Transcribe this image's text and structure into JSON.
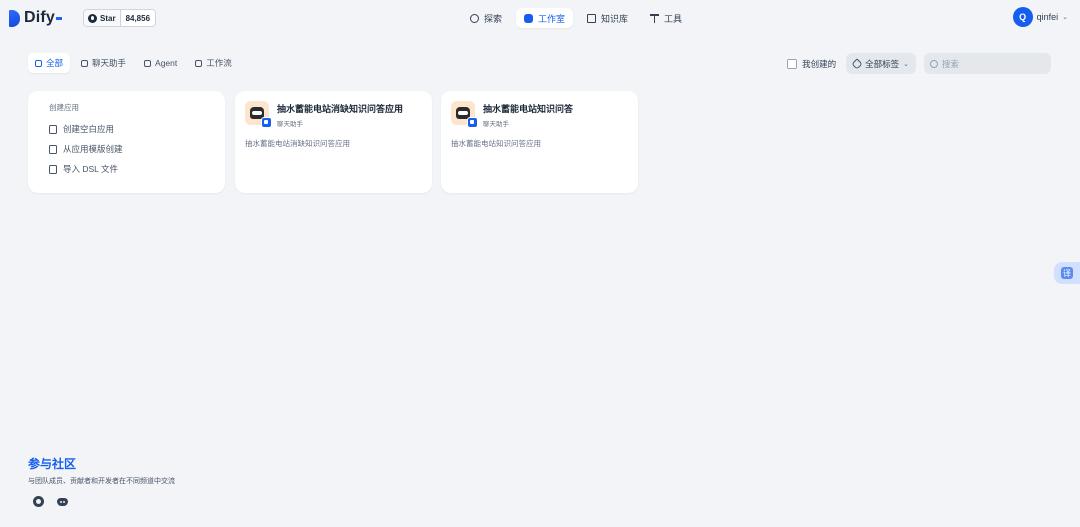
{
  "header": {
    "logo_text": "Dify",
    "github": {
      "star_label": "Star",
      "star_count": "84,856"
    },
    "nav": [
      {
        "label": "探索",
        "icon": "compass-icon",
        "active": false
      },
      {
        "label": "工作室",
        "icon": "robot-icon",
        "active": true
      },
      {
        "label": "知识库",
        "icon": "book-icon",
        "active": false
      },
      {
        "label": "工具",
        "icon": "tool-icon",
        "active": false
      }
    ],
    "user": {
      "avatar_letter": "Q",
      "name": "qinfei"
    }
  },
  "filters": {
    "tabs": [
      {
        "label": "全部",
        "icon": "grid-icon",
        "active": true
      },
      {
        "label": "聊天助手",
        "icon": "chat-icon",
        "active": false
      },
      {
        "label": "Agent",
        "icon": "agent-icon",
        "active": false
      },
      {
        "label": "工作流",
        "icon": "workflow-icon",
        "active": false
      }
    ],
    "created_by_me_label": "我创建的",
    "tags_label": "全部标签",
    "search_placeholder": "搜索"
  },
  "create_card": {
    "title": "创建应用",
    "items": [
      {
        "label": "创建空白应用",
        "icon": "file-plus-icon"
      },
      {
        "label": "从应用模版创建",
        "icon": "template-icon"
      },
      {
        "label": "导入 DSL 文件",
        "icon": "import-icon"
      }
    ]
  },
  "apps": [
    {
      "name": "抽水蓄能电站消缺知识问答应用",
      "type": "聊天助手",
      "description": "抽水蓄能电站消缺知识问答应用"
    },
    {
      "name": "抽水蓄能电站知识问答",
      "type": "聊天助手",
      "description": "抽水蓄能电站知识问答应用"
    }
  ],
  "translate_button": "译",
  "community": {
    "title": "参与社区",
    "description": "与团队成员、贡献者和开发者在不同频道中交流"
  },
  "colors": {
    "accent": "#155eef",
    "background": "#f2f4f7"
  }
}
